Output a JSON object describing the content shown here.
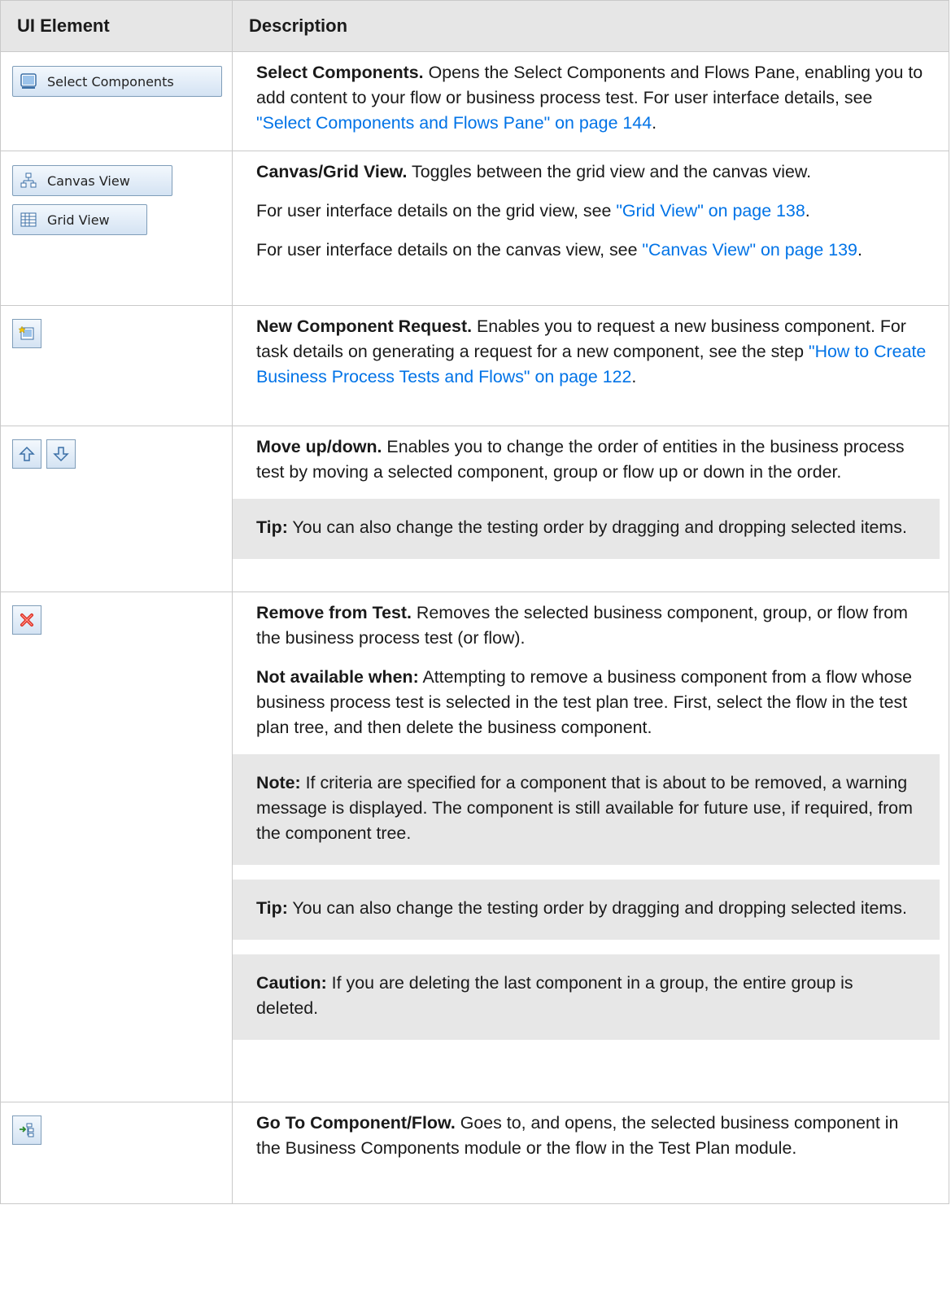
{
  "header": {
    "col1": "UI Element",
    "col2": "Description"
  },
  "rows": {
    "select_components": {
      "button_label": "Select Components",
      "icon": "select-components-icon",
      "title": "Select Components.",
      "text": " Opens the Select Components and Flows Pane, enabling you to add content to your flow or business process test. For user interface details, see ",
      "link": "\"Select Components and Flows Pane\" on page 144",
      "after": "."
    },
    "canvas_grid": {
      "canvas_label": "Canvas View",
      "grid_label": "Grid View",
      "title": "Canvas/Grid View.",
      "text": " Toggles between the grid view and the canvas view.",
      "p2_text": "For user interface details on the grid view, see ",
      "p2_link": "\"Grid View\" on page 138",
      "p2_after": ".",
      "p3_text": "For user interface details on the canvas view, see ",
      "p3_link": "\"Canvas View\" on page 139",
      "p3_after": "."
    },
    "new_request": {
      "icon": "new-component-request-icon",
      "title": "New Component Request.",
      "text": " Enables you to request a new business component. For task details on generating a request for a new component, see the step ",
      "link": "\"How to Create Business Process Tests and Flows\" on page 122",
      "after": "."
    },
    "move": {
      "title": "Move up/down.",
      "text": " Enables you to change the order of entities in the business process test by moving a selected component, group or flow up or down in the order.",
      "tip_label": "Tip:",
      "tip_text": " You can also change the testing order by dragging and dropping selected items."
    },
    "remove": {
      "title": "Remove from Test.",
      "text": " Removes the selected business component, group, or flow from the business process test (or flow).",
      "na_label": "Not available when:",
      "na_text": " Attempting to remove a business component from a flow whose business process test is selected in the test plan tree. First, select the flow in the test plan tree, and then delete the business component.",
      "note_label": "Note:",
      "note_text": " If criteria are specified for a component that is about to be removed, a warning message is displayed. The component is still available for future use, if required, from the component tree.",
      "tip_label": "Tip:",
      "tip_text": " You can also change the testing order by dragging and dropping selected items.",
      "caution_label": "Caution:",
      "caution_text": " If you are deleting the last component in a group, the entire group is deleted."
    },
    "goto": {
      "title": "Go To Component/Flow.",
      "text": " Goes to, and opens, the selected business component in the Business Components module or the flow in the Test Plan module."
    }
  },
  "colors": {
    "link": "#0073e7",
    "header_bg": "#e6e6e6",
    "callout_bg": "#e7e7e7"
  }
}
